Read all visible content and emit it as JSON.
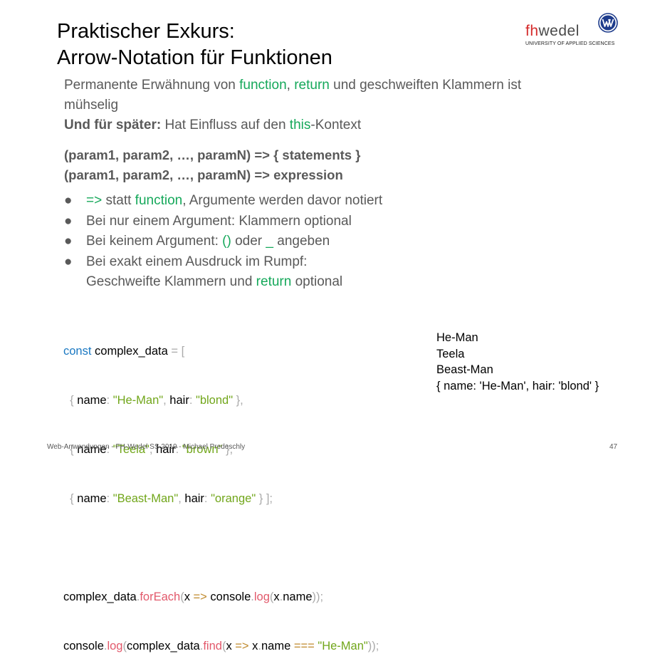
{
  "title": {
    "line1": "Praktischer Exkurs:",
    "line2": "Arrow-Notation für Funktionen"
  },
  "logo": {
    "fh": "fh",
    "wedel": "wedel",
    "sub": "UNIVERSITY OF APPLIED SCIENCES"
  },
  "intro": {
    "line1": [
      "Permanente Erwähnung von ",
      "function",
      ", ",
      "return",
      " und geschweiften Klammern ist"
    ],
    "line2": "mühselig",
    "line3": [
      "Und für später:",
      " Hat Einfluss auf den ",
      "this",
      "-Kontext"
    ]
  },
  "syntax": {
    "line1": "(param1, param2, …, paramN) => { statements }",
    "line2": "(param1, param2, …, paramN) => expression"
  },
  "bullets": {
    "b1": [
      "=>",
      " statt ",
      "function",
      ", Argumente werden davor notiert"
    ],
    "b2": "Bei nur einem Argument: Klammern optional",
    "b3": [
      "Bei keinem Argument: ",
      "()",
      " oder ",
      "_",
      " angeben"
    ],
    "b4": "Bei exakt einem Ausdruck im Rumpf:",
    "b4cont": [
      "Geschweifte Klammern und ",
      "return",
      " optional"
    ],
    "dot": "●"
  },
  "code": {
    "l1": [
      "const",
      " complex_data ",
      "= ["
    ],
    "l2": [
      "  { ",
      "name",
      ": ",
      "\"He-Man\"",
      ", ",
      "hair",
      ": ",
      "\"blond\"",
      " },"
    ],
    "l3": [
      "  { ",
      "name",
      ": ",
      "\"Teela\"",
      ", ",
      "hair",
      ": ",
      "\"brown\"",
      " },"
    ],
    "l4": [
      "  { ",
      "name",
      ": ",
      "\"Beast-Man\"",
      ", ",
      "hair",
      ": ",
      "\"orange\"",
      " } ];"
    ],
    "l6": [
      "complex_data",
      ".",
      "forEach",
      "(",
      "x",
      " => ",
      "console",
      ".",
      "log",
      "(",
      "x",
      ".",
      "name",
      "));"
    ],
    "l7": [
      "console",
      ".",
      "log",
      "(",
      "complex_data",
      ".",
      "find",
      "(",
      "x",
      " => ",
      "x",
      ".",
      "name",
      " === ",
      "\"He-Man\"",
      "));"
    ]
  },
  "output": [
    "He-Man",
    "Teela",
    "Beast-Man",
    "{ name: 'He-Man', hair: 'blond' }"
  ],
  "footer": {
    "text": "Web-Anwendungen - FH-Wedel SS 2019 - Michael Predeschly",
    "page": "47"
  },
  "colors": {
    "green": "#15a85a",
    "keyword": "#1a78c2",
    "string": "#71a61a",
    "function": "#e2596b",
    "text_gray": "#595959",
    "logo_red": "#d42a2a",
    "logo_blue": "#1e3c8c"
  }
}
